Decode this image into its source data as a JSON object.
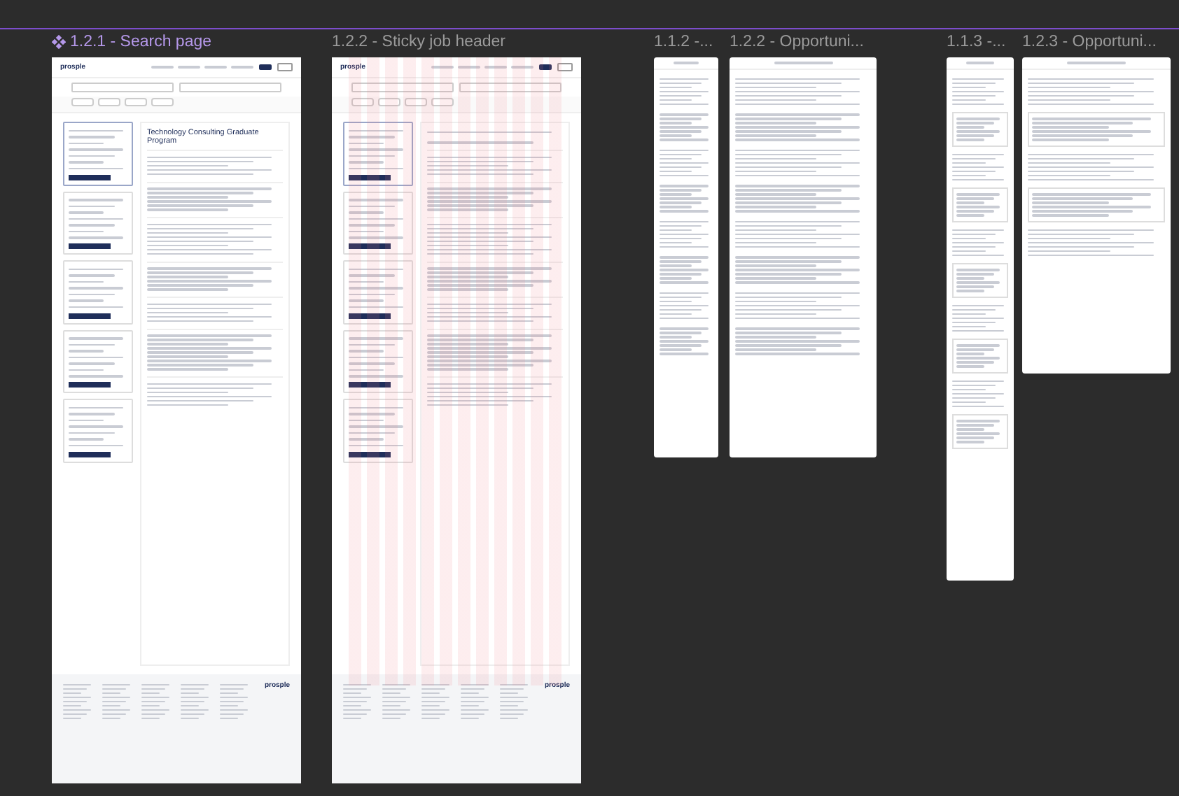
{
  "frames": [
    {
      "title": "1.2.1 - Search page",
      "kind": "component",
      "header_logo": "prosple",
      "footer_logo": "prosple",
      "job_title": "Technology Consulting Graduate Program"
    },
    {
      "title": "1.2.2 - Sticky job header",
      "kind": "frame",
      "header_logo": "prosple",
      "footer_logo": "prosple"
    },
    {
      "title": "1.1.2 -...",
      "kind": "frame"
    },
    {
      "title": "1.2.2 - Opportuni...",
      "kind": "frame"
    },
    {
      "title": "1.1.3 -...",
      "kind": "frame"
    },
    {
      "title": "1.2.3 - Opportuni...",
      "kind": "frame"
    }
  ]
}
